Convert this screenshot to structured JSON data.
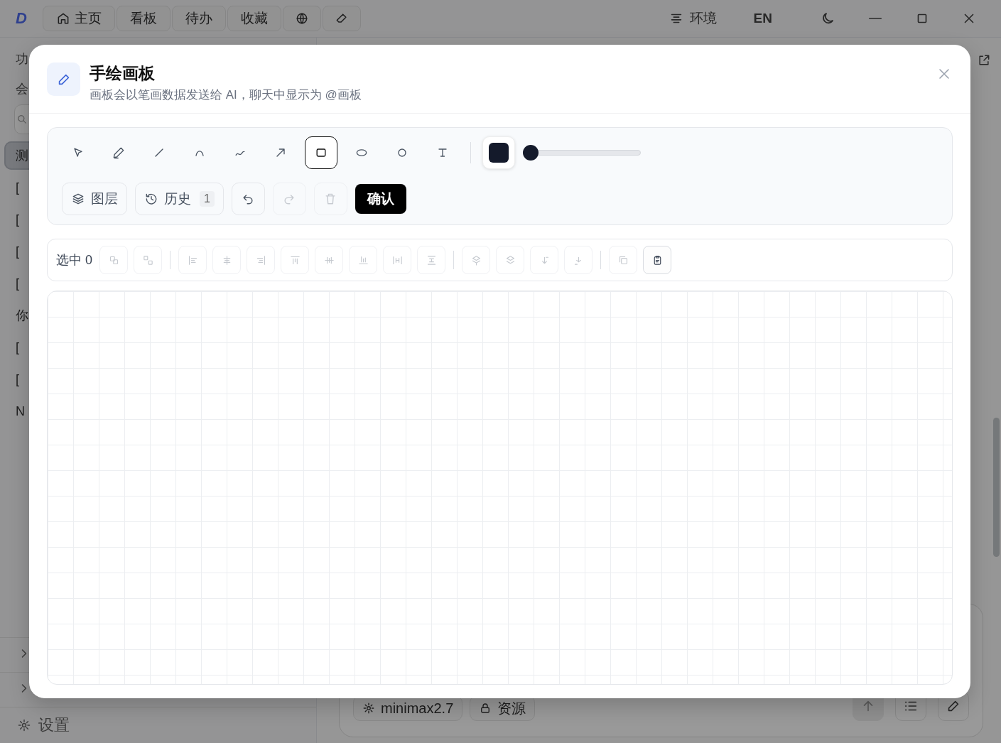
{
  "app_bar": {
    "logo": "D",
    "nav": [
      {
        "kind": "home",
        "label": "主页"
      },
      {
        "kind": "text",
        "label": "看板"
      },
      {
        "kind": "text",
        "label": "待办"
      },
      {
        "kind": "text",
        "label": "收藏"
      },
      {
        "kind": "globe"
      },
      {
        "kind": "pencil"
      }
    ],
    "environment": "环境",
    "language": "EN"
  },
  "sidebar": {
    "headings": [
      "功",
      "会"
    ],
    "conversations": [
      {
        "title": "测",
        "selected": true
      },
      {
        "title": "[",
        "selected": false
      },
      {
        "title": "[",
        "selected": false
      },
      {
        "title": "[",
        "selected": false
      },
      {
        "title": "[",
        "selected": false
      },
      {
        "title": "你",
        "selected": false
      },
      {
        "title": "[",
        "selected": false
      },
      {
        "title": "[",
        "selected": false
      },
      {
        "title": "N",
        "selected": false
      }
    ],
    "settings": "设置"
  },
  "composer": {
    "model": "minimax2.7",
    "resources": "资源"
  },
  "modal": {
    "title": "手绘画板",
    "subtitle": "画板会以笔画数据发送给 AI，聊天中显示为 @画板",
    "tools": [
      {
        "kind": "select",
        "selected": false
      },
      {
        "kind": "pen",
        "selected": false
      },
      {
        "kind": "line",
        "selected": false
      },
      {
        "kind": "arc",
        "selected": false
      },
      {
        "kind": "curve",
        "selected": false
      },
      {
        "kind": "arrow",
        "selected": false
      },
      {
        "kind": "rect",
        "selected": true
      },
      {
        "kind": "ellipse",
        "selected": false
      },
      {
        "kind": "circle",
        "selected": false
      },
      {
        "kind": "text",
        "selected": false
      }
    ],
    "stroke_width": {
      "level": 0
    },
    "actions": [
      {
        "kind": "layers",
        "label": "图层",
        "disabled": false
      },
      {
        "kind": "history",
        "label": "历史",
        "count": "1",
        "disabled": false
      },
      {
        "kind": "undo",
        "disabled": false
      },
      {
        "kind": "redo",
        "disabled": true
      },
      {
        "kind": "delete",
        "disabled": true
      },
      {
        "kind": "confirm",
        "label": "确认",
        "disabled": false
      }
    ],
    "selection": {
      "label": "选中 0",
      "groups": [
        [
          {
            "kind": "group",
            "disabled": true
          },
          {
            "kind": "ungroup",
            "disabled": true
          }
        ],
        [
          {
            "kind": "align-left",
            "disabled": true
          },
          {
            "kind": "align-center",
            "disabled": true
          },
          {
            "kind": "align-right",
            "disabled": true
          },
          {
            "kind": "align-top",
            "disabled": true
          },
          {
            "kind": "align-middle",
            "disabled": true
          },
          {
            "kind": "align-bottom",
            "disabled": true
          },
          {
            "kind": "distribute-h",
            "disabled": true
          },
          {
            "kind": "distribute-v",
            "disabled": true
          }
        ],
        [
          {
            "kind": "bring-front",
            "disabled": true
          },
          {
            "kind": "bring-forward",
            "disabled": true
          },
          {
            "kind": "send-backward",
            "disabled": true
          },
          {
            "kind": "send-back",
            "disabled": true
          }
        ],
        [
          {
            "kind": "duplicate",
            "disabled": true
          },
          {
            "kind": "paste",
            "disabled": false
          }
        ]
      ]
    }
  }
}
